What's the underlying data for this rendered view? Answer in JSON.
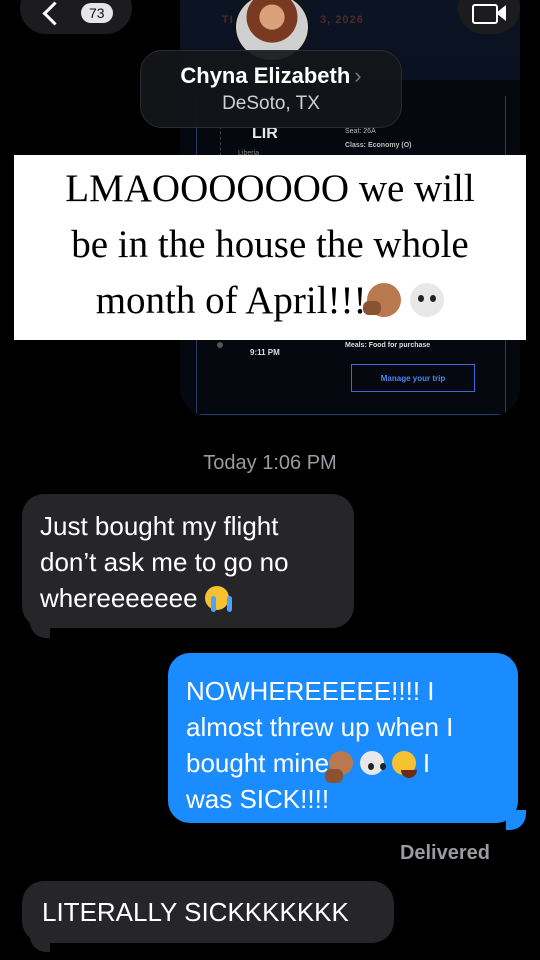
{
  "nav": {
    "back_count": "73"
  },
  "contact": {
    "name": "Chyna Elizabeth",
    "location": "DeSoto, TX"
  },
  "screenshot": {
    "date_left": "TI",
    "date_right": "3, 2026",
    "airport_code": "LIR",
    "airport_city": "Liberia",
    "seat": "Seat: 26A",
    "class": "Class: Economy (O)",
    "meals": "Meals: Food for purchase",
    "time": "9:11 PM",
    "manage_button": "Manage your trip"
  },
  "caption": {
    "line1": "LMAOOOOOOO we will",
    "line2": "be in the house the whole",
    "line3": "month of April!!!"
  },
  "timestamp": "Today 1:06 PM",
  "messages": [
    {
      "direction": "received",
      "lines": [
        "Just bought my flight",
        "don’t ask me to go no",
        "whereeeeeee"
      ]
    },
    {
      "direction": "sent",
      "lines": [
        "NOWHEREEEEE!!!! I",
        "almost threw up when I",
        "bought mine",
        "I",
        "was SICK!!!!"
      ]
    },
    {
      "direction": "received",
      "lines": [
        "LITERALLY SICKKKKKKK"
      ]
    }
  ],
  "status": "Delivered"
}
